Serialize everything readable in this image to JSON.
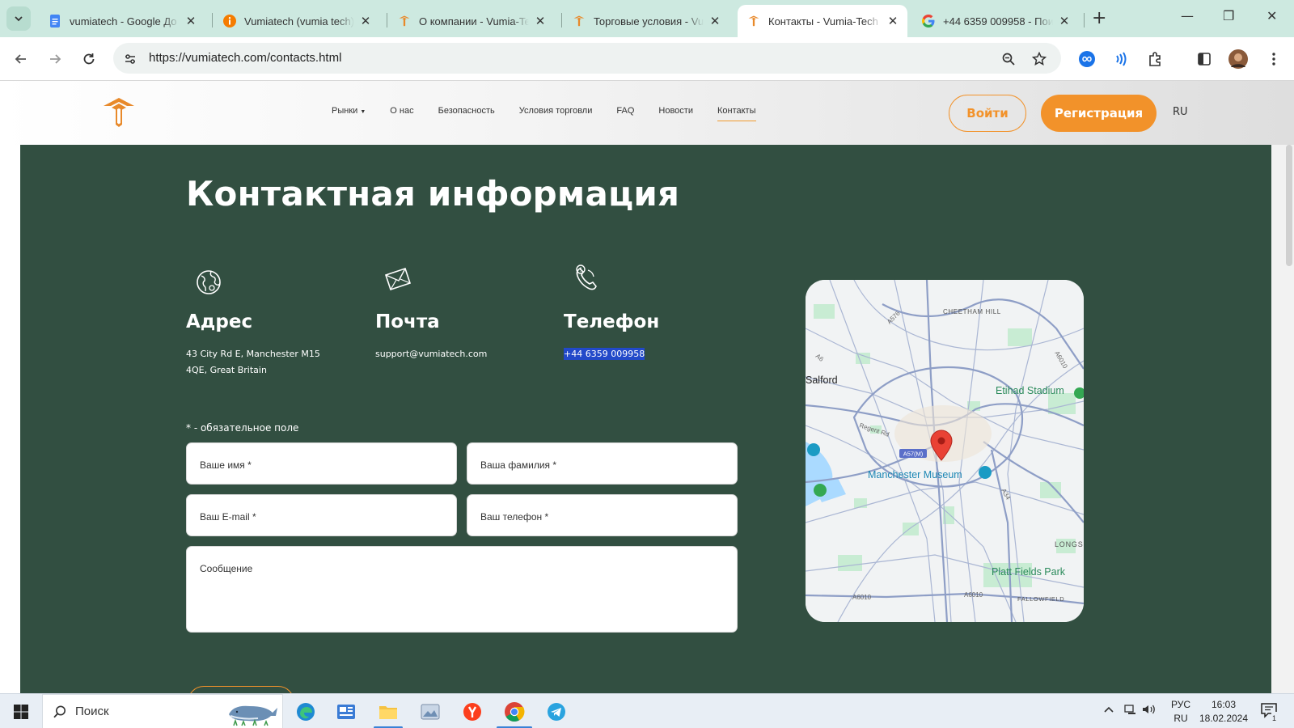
{
  "browser": {
    "tabs": [
      {
        "title": "vumiatech - Google До",
        "favicon": "google-docs-icon",
        "active": false
      },
      {
        "title": "Vumiatech (vumia tech)",
        "favicon": "info-icon",
        "active": false
      },
      {
        "title": "О компании - Vumia-Te",
        "favicon": "vumia-logo-icon",
        "active": false
      },
      {
        "title": "Торговые условия - Vu",
        "favicon": "vumia-logo-icon",
        "active": false
      },
      {
        "title": "Контакты - Vumia-Tech",
        "favicon": "vumia-logo-icon",
        "active": true
      },
      {
        "title": "+44 6359 009958 - Пои",
        "favicon": "google-g-icon",
        "active": false
      }
    ],
    "url": "https://vumiatech.com/contacts.html"
  },
  "site": {
    "nav": [
      "Рынки",
      "О нас",
      "Безопасность",
      "Условия торговли",
      "FAQ",
      "Новости",
      "Контакты"
    ],
    "nav_active": "Контакты",
    "login_label": "Войти",
    "register_label": "Регистрация",
    "lang": "RU",
    "accent": "#f2922a",
    "hero_bg": "#324f41"
  },
  "contact": {
    "title": "Контактная информация",
    "address_title": "Адрес",
    "address_line1": "43 City Rd E, Manchester M15",
    "address_line2": "4QE, Great Britain",
    "mail_title": "Почта",
    "mail_value": "support@vumiatech.com",
    "phone_title": "Телефон",
    "phone_value": "+44 6359 009958"
  },
  "form": {
    "required_note": "* - обязательное поле",
    "first_name": "Ваше имя *",
    "last_name": "Ваша фамилия *",
    "email": "Ваш E-mail *",
    "phone": "Ваш телефон *",
    "message": "Сообщение"
  },
  "map": {
    "city": "Manchester",
    "labels": {
      "salford": "Salford",
      "etihad": "Etihad Stadium",
      "museum": "Manchester Museum",
      "platt": "Platt Fields Park",
      "cheetham": "CHEETHAM HILL",
      "longsight": "LONGS",
      "fallowfield": "FALLOWFIELD",
      "regent": "Regent Rd",
      "a57m": "A57(M)",
      "a576": "A576",
      "a6": "A6",
      "a6010_top": "A6010",
      "a6010_bottom": "A6010",
      "a34": "A34",
      "a6010_left": "A6010"
    }
  },
  "taskbar": {
    "search_label": "Поиск",
    "lang_top": "РУС",
    "lang_bottom": "RU",
    "time": "16:03",
    "date": "18.02.2024",
    "notifications": "1"
  }
}
